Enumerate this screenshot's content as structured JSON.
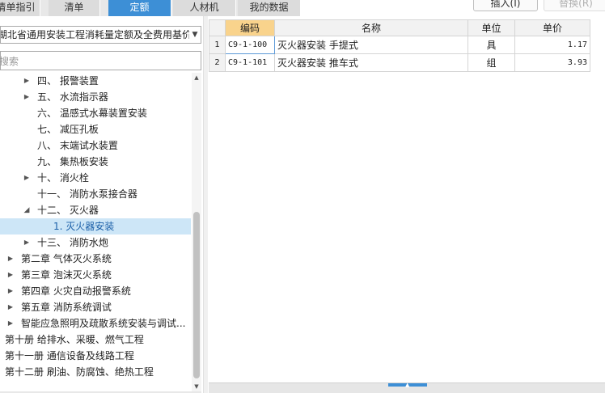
{
  "tabs": [
    {
      "label": "清单指引",
      "active": false
    },
    {
      "label": "清单",
      "active": false
    },
    {
      "label": "定额",
      "active": true
    },
    {
      "label": "人材机",
      "active": false
    },
    {
      "label": "我的数据",
      "active": false
    }
  ],
  "toolbar": {
    "insert_label": "插入(I)",
    "replace_label": "替换(R)"
  },
  "library_select": {
    "value": "湖北省通用安装工程消耗量定额及全费用基价表"
  },
  "search": {
    "placeholder": "搜索"
  },
  "tree": [
    {
      "label": "四、 报警装置",
      "arrow": "right",
      "level": 2
    },
    {
      "label": "五、 水流指示器",
      "arrow": "right",
      "level": 2
    },
    {
      "label": "六、 温感式水幕装置安装",
      "arrow": "none",
      "level": 2
    },
    {
      "label": "七、 减压孔板",
      "arrow": "none",
      "level": 2
    },
    {
      "label": "八、 末端试水装置",
      "arrow": "none",
      "level": 2
    },
    {
      "label": "九、 集热板安装",
      "arrow": "none",
      "level": 2
    },
    {
      "label": "十、 消火栓",
      "arrow": "right",
      "level": 2
    },
    {
      "label": "十一、 消防水泵接合器",
      "arrow": "none",
      "level": 2
    },
    {
      "label": "十二、 灭火器",
      "arrow": "down",
      "level": 2
    },
    {
      "label": "1. 灭火器安装",
      "arrow": "none",
      "level": 3,
      "selected": true
    },
    {
      "label": "十三、 消防水炮",
      "arrow": "right",
      "level": 2
    },
    {
      "label": "第二章 气体灭火系统",
      "arrow": "right",
      "level": 1
    },
    {
      "label": "第三章 泡沫灭火系统",
      "arrow": "right",
      "level": 1
    },
    {
      "label": "第四章 火灾自动报警系统",
      "arrow": "right",
      "level": 1
    },
    {
      "label": "第五章 消防系统调试",
      "arrow": "right",
      "level": 1
    },
    {
      "label": "智能应急照明及疏散系统安装与调试...",
      "arrow": "right",
      "level": 1
    },
    {
      "label": "第十册 给排水、采暖、燃气工程",
      "arrow": "none",
      "level": 0
    },
    {
      "label": "第十一册 通信设备及线路工程",
      "arrow": "none",
      "level": 0
    },
    {
      "label": "第十二册 刷油、防腐蚀、绝热工程",
      "arrow": "none",
      "level": 0
    }
  ],
  "table": {
    "headers": {
      "code": "编码",
      "name": "名称",
      "unit": "单位",
      "price": "单价"
    },
    "rows": [
      {
        "index": "1",
        "code": "C9-1-100",
        "name": "灭火器安装 手提式",
        "unit": "具",
        "price": "1.17"
      },
      {
        "index": "2",
        "code": "C9-1-101",
        "name": "灭火器安装 推车式",
        "unit": "组",
        "price": "3.93"
      }
    ]
  },
  "colors": {
    "accent": "#3d8fd6",
    "selected_row": "#cde6f7",
    "sorted_header": "#f9d38c"
  }
}
